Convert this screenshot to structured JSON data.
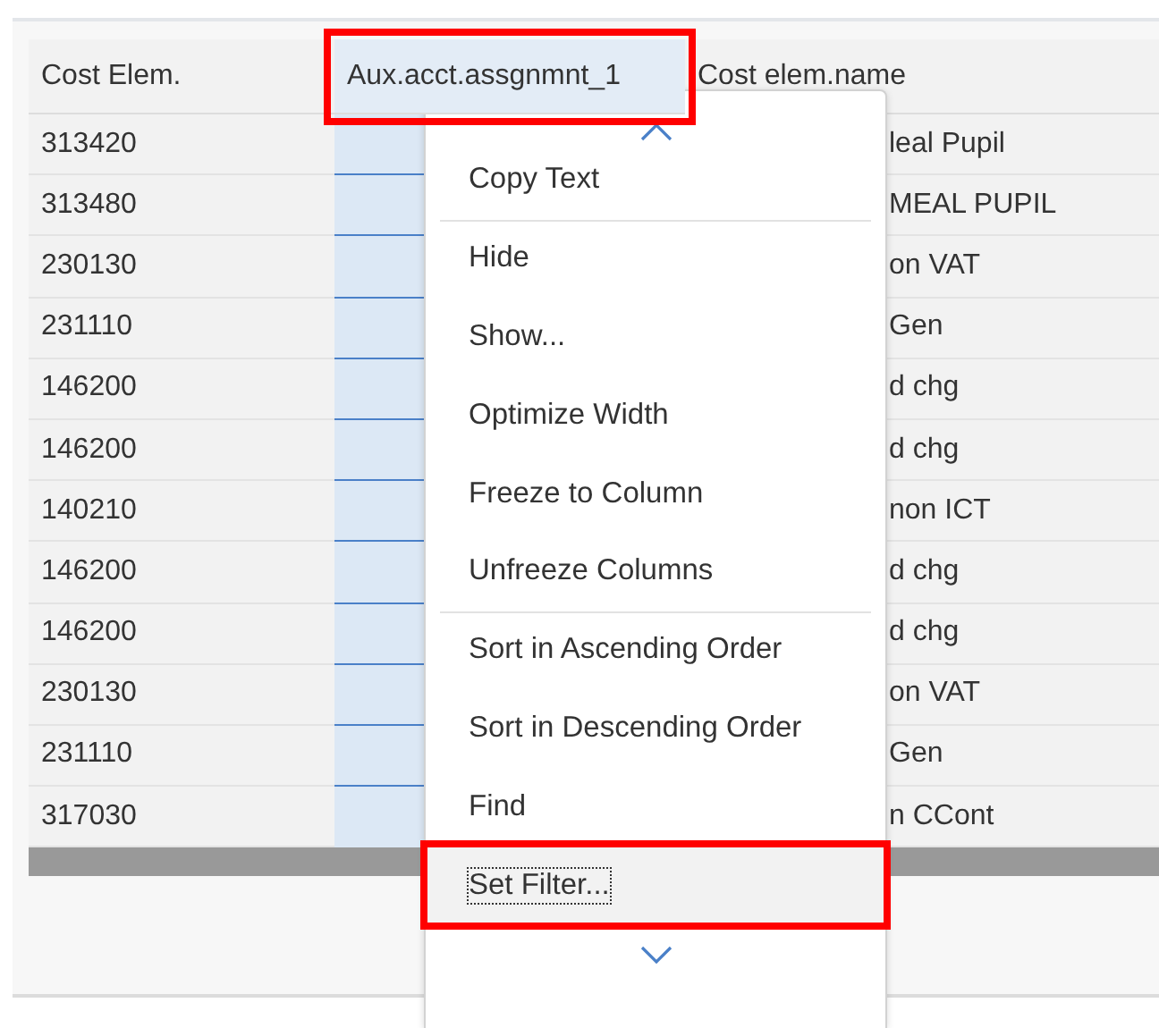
{
  "table": {
    "columns": [
      {
        "label": "Cost Elem.",
        "selected": false,
        "highlighted": false
      },
      {
        "label": "Aux.acct.assgnmnt_1",
        "selected": true,
        "highlighted": true
      },
      {
        "label": "Cost elem.name",
        "selected": false,
        "highlighted": false
      }
    ],
    "rows": [
      [
        "313420",
        "",
        "leal Pupil"
      ],
      [
        "313480",
        "",
        "MEAL PUPIL"
      ],
      [
        "230130",
        "",
        "on VAT"
      ],
      [
        "231110",
        "",
        "Gen"
      ],
      [
        "146200",
        "",
        "d chg"
      ],
      [
        "146200",
        "",
        "d chg"
      ],
      [
        "140210",
        "",
        "non ICT"
      ],
      [
        "146200",
        "",
        "d chg"
      ],
      [
        "146200",
        "",
        "d chg"
      ],
      [
        "230130",
        "",
        "on VAT"
      ],
      [
        "231110",
        "",
        "Gen"
      ],
      [
        "317030",
        "",
        "n CCont"
      ]
    ]
  },
  "context_menu": {
    "items": [
      {
        "label": "Copy Text",
        "separator_before": false,
        "focused": false,
        "highlighted": false
      },
      {
        "label": "Hide",
        "separator_before": true,
        "focused": false,
        "highlighted": false
      },
      {
        "label": "Show...",
        "separator_before": false,
        "focused": false,
        "highlighted": false
      },
      {
        "label": "Optimize Width",
        "separator_before": false,
        "focused": false,
        "highlighted": false
      },
      {
        "label": "Freeze to Column",
        "separator_before": false,
        "focused": false,
        "highlighted": false
      },
      {
        "label": "Unfreeze Columns",
        "separator_before": false,
        "focused": false,
        "highlighted": false
      },
      {
        "label": "Sort in Ascending Order",
        "separator_before": true,
        "focused": false,
        "highlighted": false
      },
      {
        "label": "Sort in Descending Order",
        "separator_before": false,
        "focused": false,
        "highlighted": false
      },
      {
        "label": "Find",
        "separator_before": false,
        "focused": false,
        "highlighted": false
      },
      {
        "label": "Set Filter...",
        "separator_before": false,
        "focused": true,
        "highlighted": true
      }
    ]
  }
}
